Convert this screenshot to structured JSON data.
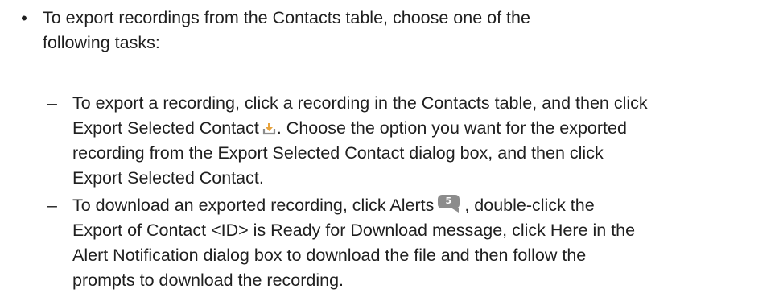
{
  "bullet": {
    "glyph": "•",
    "lines": [
      "To export recordings from the Contacts table, choose one of the",
      "following tasks:"
    ]
  },
  "sub_items": [
    {
      "dash": "–",
      "line1_before_icon": "To export a recording, click a recording in the Contacts table, and then click",
      "line2_before_icon": "Export Selected Contact",
      "icon": "export-download-icon",
      "line2_after_icon": ". Choose the option you want for the exported",
      "rest_lines": [
        "recording from the Export Selected Contact dialog box, and then click",
        "Export Selected Contact."
      ]
    },
    {
      "dash": "–",
      "line1_before_icon": "To download an exported recording, click Alerts",
      "icon": "alerts-badge-icon",
      "alerts_count": "5",
      "line1_after_icon": ", double-click the",
      "rest_lines": [
        "Export of Contact <ID> is Ready for Download message, click Here in the",
        "Alert Notification dialog box to download the file and then follow the",
        "prompts to download the recording."
      ]
    }
  ],
  "colors": {
    "text": "#1f1f1f",
    "icon_gray": "#8c8c8c",
    "icon_orange": "#e8a33c"
  }
}
